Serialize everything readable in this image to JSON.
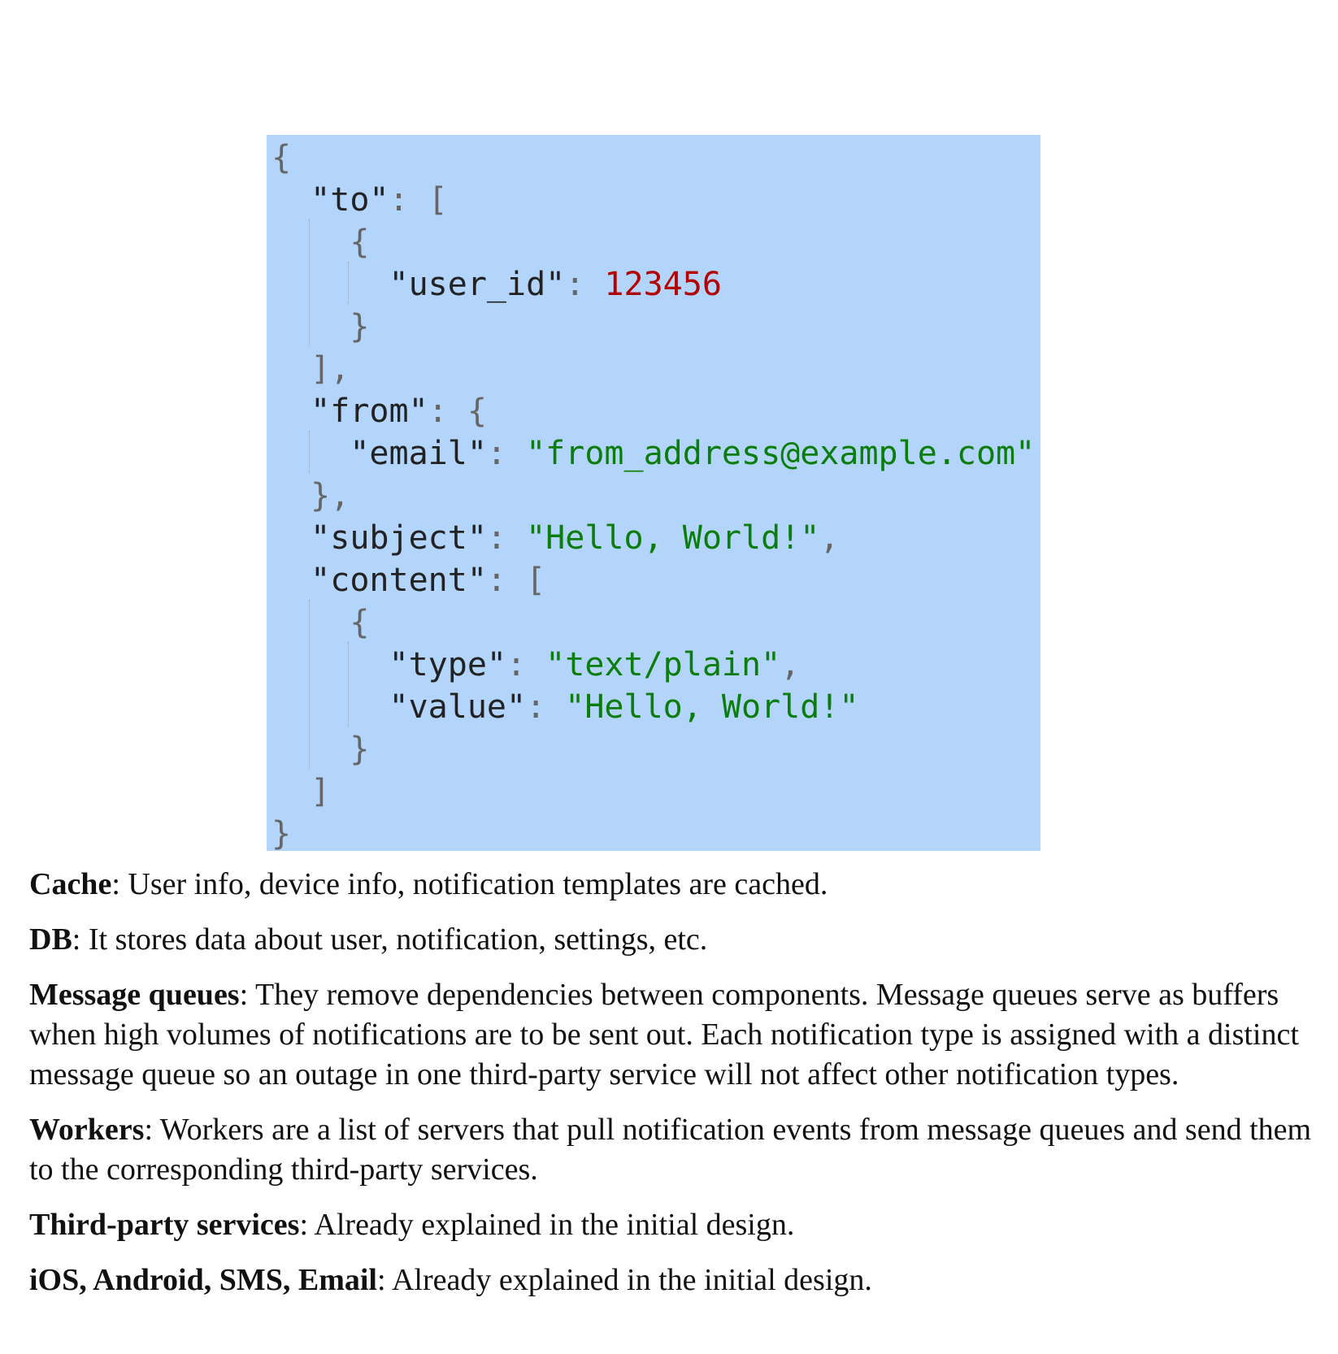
{
  "code": {
    "lines": [
      {
        "parts": [
          {
            "t": "{",
            "c": "p"
          }
        ]
      },
      {
        "parts": [
          {
            "t": "  ",
            "c": "p"
          },
          {
            "t": "\"to\"",
            "c": "k"
          },
          {
            "t": ": [",
            "c": "p"
          }
        ]
      },
      {
        "parts": [
          {
            "t": "    {",
            "c": "p"
          }
        ]
      },
      {
        "parts": [
          {
            "t": "      ",
            "c": "p"
          },
          {
            "t": "\"user_id\"",
            "c": "k"
          },
          {
            "t": ": ",
            "c": "p"
          },
          {
            "t": "123456",
            "c": "n"
          }
        ]
      },
      {
        "parts": [
          {
            "t": "    }",
            "c": "p"
          }
        ]
      },
      {
        "parts": [
          {
            "t": "  ],",
            "c": "p"
          }
        ]
      },
      {
        "parts": [
          {
            "t": "  ",
            "c": "p"
          },
          {
            "t": "\"from\"",
            "c": "k"
          },
          {
            "t": ": {",
            "c": "p"
          }
        ]
      },
      {
        "parts": [
          {
            "t": "    ",
            "c": "p"
          },
          {
            "t": "\"email\"",
            "c": "k"
          },
          {
            "t": ": ",
            "c": "p"
          },
          {
            "t": "\"from_address@example.com\"",
            "c": "s"
          }
        ]
      },
      {
        "parts": [
          {
            "t": "  },",
            "c": "p"
          }
        ]
      },
      {
        "parts": [
          {
            "t": "  ",
            "c": "p"
          },
          {
            "t": "\"subject\"",
            "c": "k"
          },
          {
            "t": ": ",
            "c": "p"
          },
          {
            "t": "\"Hello, World!\"",
            "c": "s"
          },
          {
            "t": ",",
            "c": "p"
          }
        ]
      },
      {
        "parts": [
          {
            "t": "  ",
            "c": "p"
          },
          {
            "t": "\"content\"",
            "c": "k"
          },
          {
            "t": ": [",
            "c": "p"
          }
        ]
      },
      {
        "parts": [
          {
            "t": "    {",
            "c": "p"
          }
        ]
      },
      {
        "parts": [
          {
            "t": "      ",
            "c": "p"
          },
          {
            "t": "\"type\"",
            "c": "k"
          },
          {
            "t": ": ",
            "c": "p"
          },
          {
            "t": "\"text/plain\"",
            "c": "s"
          },
          {
            "t": ",",
            "c": "p"
          }
        ]
      },
      {
        "parts": [
          {
            "t": "      ",
            "c": "p"
          },
          {
            "t": "\"value\"",
            "c": "k"
          },
          {
            "t": ": ",
            "c": "p"
          },
          {
            "t": "\"Hello, World!\"",
            "c": "s"
          }
        ]
      },
      {
        "parts": [
          {
            "t": "    }",
            "c": "p"
          }
        ]
      },
      {
        "parts": [
          {
            "t": "  ]",
            "c": "p"
          }
        ]
      },
      {
        "parts": [
          {
            "t": "}",
            "c": "p"
          }
        ]
      }
    ]
  },
  "paragraphs": [
    {
      "term": "Cache",
      "text": ": User info, device info, notification templates are cached."
    },
    {
      "term": "DB",
      "text": ": It stores data about user, notification, settings, etc."
    },
    {
      "term": "Message queues",
      "text": ": They remove dependencies between components. Message queues serve as buffers when high volumes of notifications are to be sent out. Each notification type is assigned with a distinct message queue so an outage in one third-party service will not affect other notification types."
    },
    {
      "term": "Workers",
      "text": ": Workers are a list of servers that pull notification events from message queues and send them to the corresponding third-party services."
    },
    {
      "term": "Third-party services",
      "text": ": Already explained in the initial design."
    },
    {
      "term": "iOS, Android, SMS, Email",
      "text": ": Already explained in the initial design."
    }
  ]
}
